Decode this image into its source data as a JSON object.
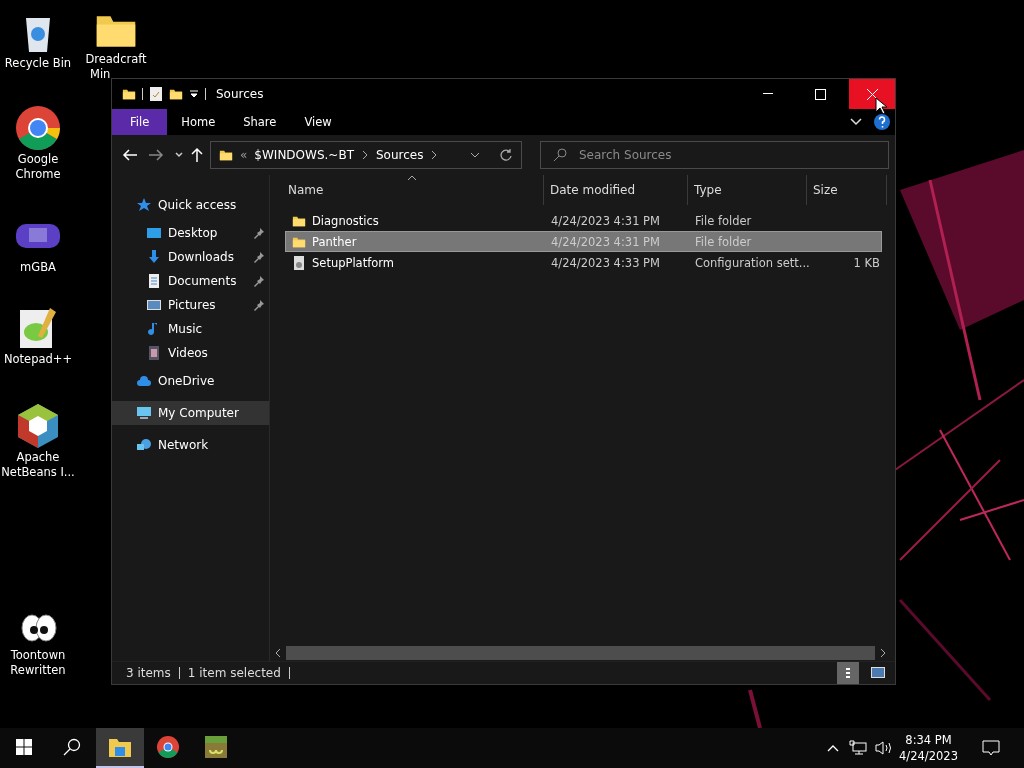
{
  "desktop_icons": [
    {
      "kind": "recycle",
      "label": "Recycle Bin"
    },
    {
      "kind": "chrome",
      "label": "Google Chrome"
    },
    {
      "kind": "gba",
      "label": "mGBA"
    },
    {
      "kind": "notepad",
      "label": "Notepad++"
    },
    {
      "kind": "netbeans",
      "label": "Apache NetBeans I..."
    },
    {
      "kind": "toon",
      "label": "Toontown Rewritten"
    }
  ],
  "folder_icon": {
    "label": "Dreadcraft",
    "label_cut": "Min"
  },
  "window": {
    "title": "Sources",
    "ribbon_tabs": [
      {
        "label": "File",
        "kind": "menu"
      },
      {
        "label": "Home",
        "kind": "tab"
      },
      {
        "label": "Share",
        "kind": "tab"
      },
      {
        "label": "View",
        "kind": "tab"
      }
    ],
    "address": {
      "overflow": "«",
      "crumbs": [
        "$WINDOWS.~BT",
        "Sources"
      ]
    },
    "search": {
      "placeholder": "Search Sources"
    },
    "navigation": [
      {
        "label": "Quick access",
        "kind": "star",
        "selected": false,
        "children": [
          {
            "label": "Desktop",
            "kind": "desktop",
            "pinned": true
          },
          {
            "label": "Downloads",
            "kind": "download",
            "pinned": true
          },
          {
            "label": "Documents",
            "kind": "document",
            "pinned": true
          },
          {
            "label": "Pictures",
            "kind": "pictures",
            "pinned": true
          },
          {
            "label": "Music",
            "kind": "music",
            "pinned": false
          },
          {
            "label": "Videos",
            "kind": "videos",
            "pinned": false
          }
        ]
      },
      {
        "label": "OneDrive",
        "kind": "cloud",
        "selected": false
      },
      {
        "label": "My Computer",
        "kind": "computer",
        "selected": true
      },
      {
        "label": "Network",
        "kind": "network",
        "selected": false
      }
    ],
    "columns": [
      "Name",
      "Date modified",
      "Type",
      "Size"
    ],
    "rows": [
      {
        "kind": "folder",
        "name": "Diagnostics",
        "date": "4/24/2023 4:31 PM",
        "type": "File folder",
        "size": "",
        "selected": false
      },
      {
        "kind": "folder",
        "name": "Panther",
        "date": "4/24/2023 4:31 PM",
        "type": "File folder",
        "size": "",
        "selected": true
      },
      {
        "kind": "config",
        "name": "SetupPlatform",
        "date": "4/24/2023 4:33 PM",
        "type": "Configuration sett...",
        "size": "1 KB",
        "selected": false
      }
    ],
    "status": [
      "3 items",
      "1 item selected"
    ]
  },
  "taskbar": {
    "apps": [
      {
        "kind": "explorer",
        "active": true
      },
      {
        "kind": "chrome",
        "active": false
      },
      {
        "kind": "minecraft",
        "active": false
      }
    ],
    "time": "8:34 PM",
    "date": "4/24/2023"
  }
}
